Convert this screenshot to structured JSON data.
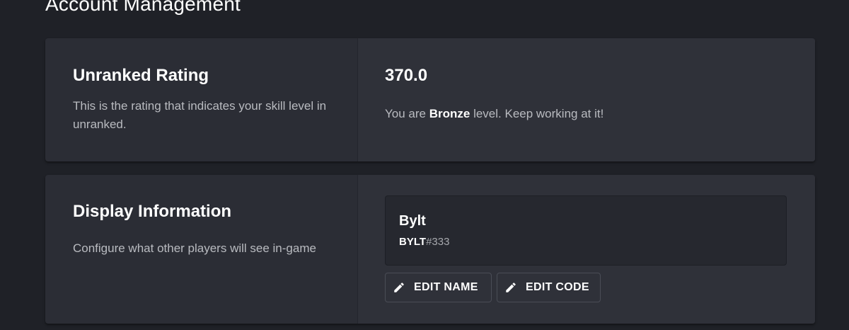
{
  "page": {
    "title": "Account Management"
  },
  "rating_card": {
    "title": "Unranked Rating",
    "description": "This is the rating that indicates your skill level in unranked.",
    "value": "370.0",
    "status_prefix": "You are ",
    "level": "Bronze",
    "status_suffix": " level. Keep working at it!"
  },
  "display_card": {
    "title": "Display Information",
    "description": "Configure what other players will see in-game",
    "profile": {
      "name": "Bylt",
      "tag_name": "BYLT",
      "tag_code": "#333"
    },
    "edit_name_label": "EDIT NAME",
    "edit_code_label": "EDIT CODE",
    "icons": {
      "edit": "pencil-icon"
    }
  }
}
